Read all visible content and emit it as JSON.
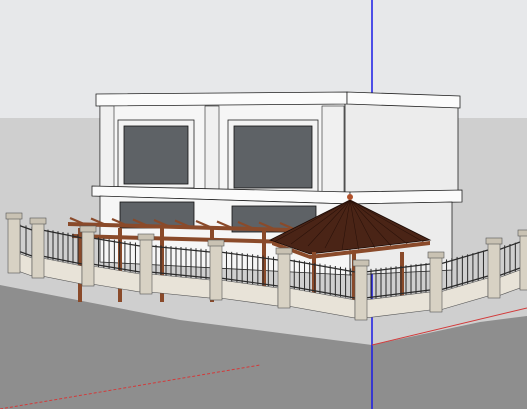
{
  "app": {
    "view_kind": "3D modeling viewport",
    "model_description_hidden": true
  },
  "viewport": {
    "sky_color": "#e7e8ea",
    "ground_color": "#cfcfcf",
    "road_color": "#8e8e8e",
    "axis_blue": "#1a1ae6",
    "axis_red": "#d23a3a",
    "axis_green": "#3aa23a"
  },
  "model": {
    "wall_color": "#f6f6f6",
    "window_color": "#5e6266",
    "timber_color": "#8a4a2a",
    "roof_color": "#4a2416",
    "fence_post_color": "#d8d2c4",
    "fence_rail_color": "#2a2a2a"
  }
}
